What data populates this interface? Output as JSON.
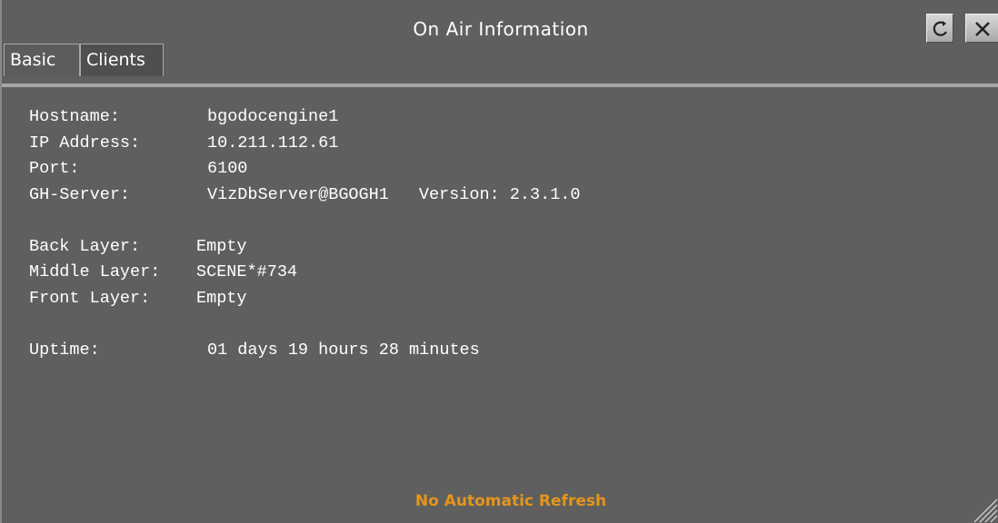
{
  "window": {
    "title": "On Air Information",
    "refresh_icon": "refresh-icon",
    "close_icon": "close-icon"
  },
  "tabs": [
    {
      "label": "Basic",
      "active": true
    },
    {
      "label": "Clients",
      "active": false
    }
  ],
  "info": {
    "hostname_label": "Hostname:",
    "hostname": "bgodocengine1",
    "ip_label": "IP Address:",
    "ip": "10.211.112.61",
    "port_label": "Port:",
    "port": "6100",
    "gh_label": "GH-Server:",
    "gh_server": "VizDbServer@BGOGH1",
    "version_label": "Version:",
    "version": "2.3.1.0",
    "back_label": "Back Layer:",
    "back": "Empty",
    "middle_label": "Middle Layer:",
    "middle": "SCENE*#734",
    "front_label": "Front Layer:",
    "front": "Empty",
    "uptime_label": "Uptime:",
    "uptime": "01 days 19 hours 28 minutes"
  },
  "status": {
    "text": "No Automatic Refresh",
    "color": "#e59519"
  },
  "colors": {
    "background": "#5f5f5f",
    "text": "#ffffff"
  }
}
